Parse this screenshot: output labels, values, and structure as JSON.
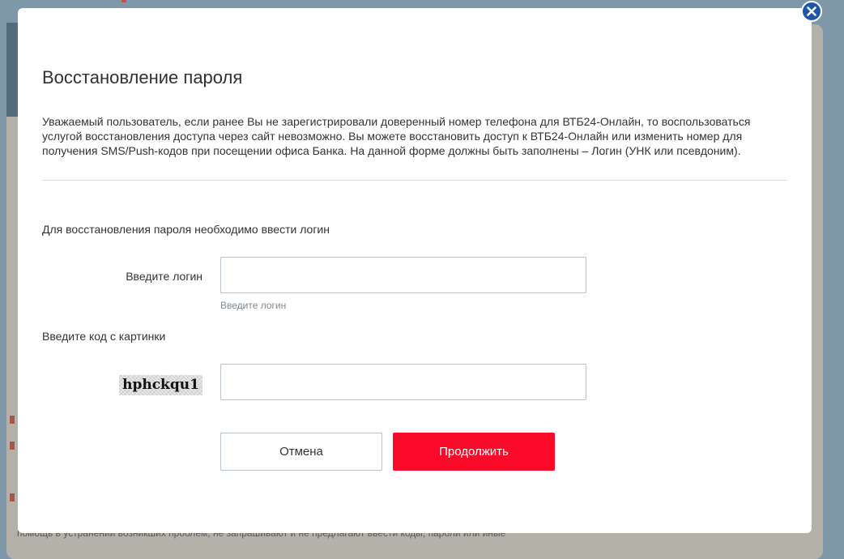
{
  "modal": {
    "title": "Восстановление пароля",
    "description": "Уважаемый пользователь, если ранее Вы не зарегистрировали доверенный номер телефона для ВТБ24-Онлайн, то воспользоваться услугой восстановления доступа через сайт невозможно. Вы можете восстановить доступ к ВТБ24-Онлайн или изменить номер для получения SMS/Push-кодов при посещении офиса Банка. На данной форме должны быть заполнены – Логин (УНК или псевдоним).",
    "instruction": "Для восстановления пароля необходимо ввести логин",
    "close_icon": "close-icon"
  },
  "login": {
    "label": "Введите логин",
    "value": "",
    "placeholder": "",
    "hint": "Введите логин"
  },
  "captcha": {
    "label": "Введите код с картинки",
    "image_text": "hphckqu1",
    "value": ""
  },
  "buttons": {
    "cancel": "Отмена",
    "continue": "Продолжить"
  },
  "background": {
    "text": "помощь в устранении возникших проблем, не запрашивают и не предлагают ввести коды, пароли или иные"
  },
  "colors": {
    "accent": "#fb0a2a",
    "close_button": "#1e57a9",
    "overlay": "#7f98a9"
  }
}
